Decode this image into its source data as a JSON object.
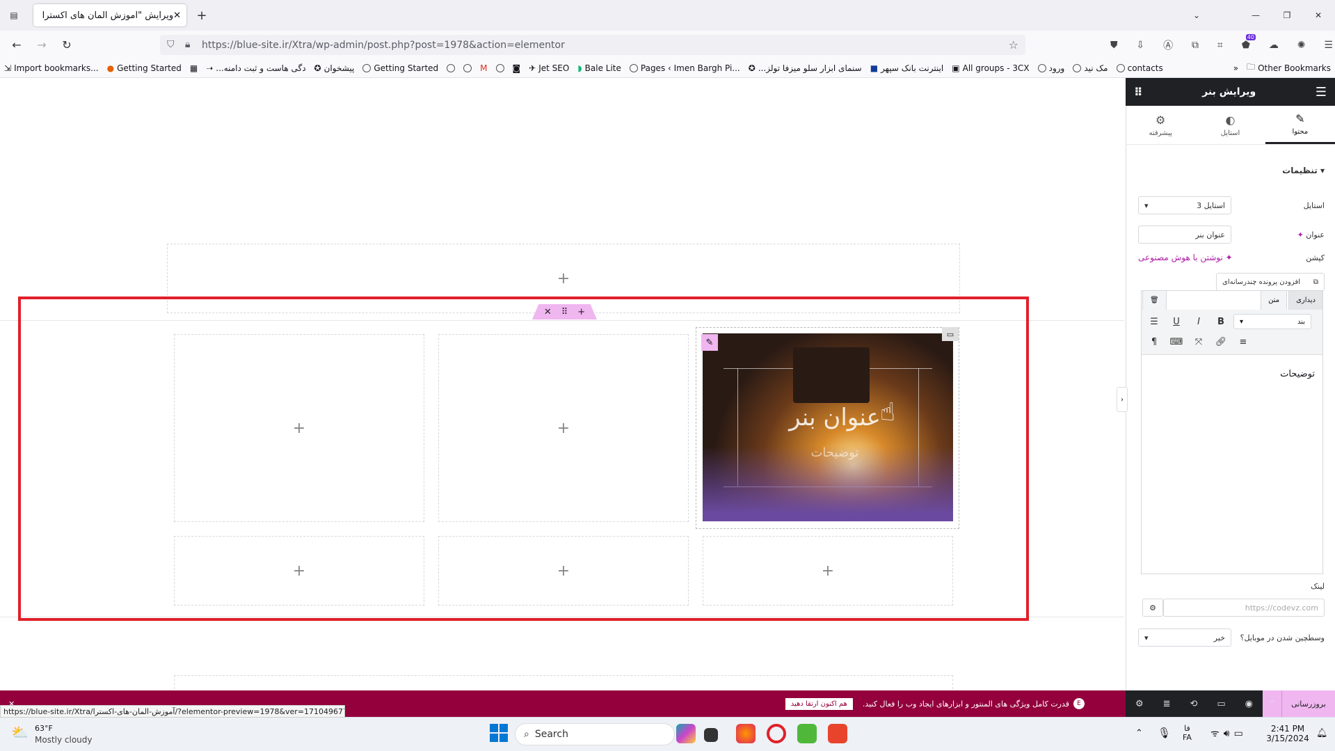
{
  "browser": {
    "tab_title": "ویرایش \"آموزش المان های اکسترا – ...\"",
    "url": "https://blue-site.ir/Xtra/wp-admin/post.php?post=1978&action=elementor",
    "extension_badge": "40",
    "bookmarks": [
      "Import bookmarks...",
      "Getting Started",
      "...دگی هاست و ثبت دامنه",
      "پیشخوان",
      "Getting Started",
      "Jet SEO",
      "Bale Lite",
      "Pages ‹ Imen Bargh Pi...",
      "...سنمای ابزار سلو میزفا تولز",
      "اینترنت بانک سپهر",
      "All groups - 3CX",
      "ورود",
      "مک نید",
      "contacts"
    ],
    "other_bookmarks": "Other Bookmarks"
  },
  "canvas": {
    "add_symbol": "+",
    "banner_title": "عنوان بنر",
    "banner_desc": "توضیحات"
  },
  "panel": {
    "title": "ویرایش بنر",
    "tabs": [
      "محتوا",
      "استایل",
      "پیشرفته"
    ],
    "section": "تنظیمات",
    "style_label": "استایل",
    "style_value": "استایل 3",
    "heading_label": "عنوان",
    "heading_value": "عنوان بنر",
    "caption_label": "کپشن",
    "ai_link": "نوشتن با هوش مصنوعی",
    "add_media": "افزودن پرونده چندرسانه‌ای",
    "editor_tabs": [
      "دیداری",
      "متن"
    ],
    "paragraph_select": "بند",
    "editor_content": "توضیحات",
    "link_label": "لینک",
    "link_placeholder": "https://codevz.com",
    "mobile_label": "وسطچین شدن در موبایل؟",
    "mobile_value": "خیر"
  },
  "notice": {
    "text": "قدرت کامل ویژگی های المنتور و ابزارهای ایجاد وب را فعال کنید.",
    "button": "هم اکنون ارتقا دهید",
    "update": "بروزرسانی"
  },
  "status_url": "https://blue-site.ir/Xtra/آموزش-المان-های-اکسترا/?elementor-preview=1978&ver=1710496778",
  "taskbar": {
    "weather_temp": "63°F",
    "weather_desc": "Mostly cloudy",
    "search": "Search",
    "lang1": "فا",
    "lang2": "FA",
    "time": "2:41 PM",
    "date": "3/15/2024"
  },
  "colors": {
    "accent": "#93003c",
    "highlight": "#e0202a",
    "handle": "#f0b6f0",
    "panel_dark": "#1f2124"
  }
}
